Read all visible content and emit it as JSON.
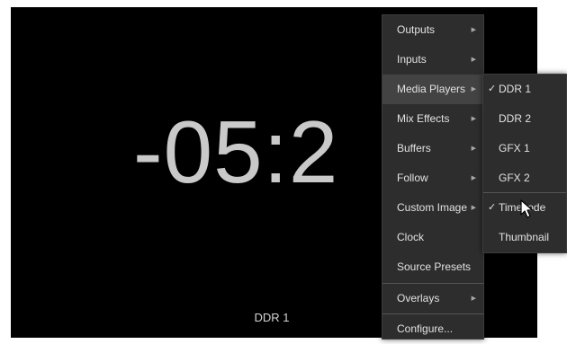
{
  "preview": {
    "timecode": "-05:2",
    "source_label": "DDR 1"
  },
  "main_menu": {
    "items": [
      {
        "label": "Outputs",
        "has_submenu": true
      },
      {
        "label": "Inputs",
        "has_submenu": true
      },
      {
        "label": "Media Players",
        "has_submenu": true
      },
      {
        "label": "Mix Effects",
        "has_submenu": true
      },
      {
        "label": "Buffers",
        "has_submenu": true
      },
      {
        "label": "Follow",
        "has_submenu": true
      },
      {
        "label": "Custom Image",
        "has_submenu": true
      },
      {
        "label": "Clock",
        "has_submenu": false
      },
      {
        "label": "Source Presets",
        "has_submenu": false
      },
      {
        "label": "Overlays",
        "has_submenu": true
      },
      {
        "label": "Configure...",
        "has_submenu": false
      }
    ],
    "highlighted": "Media Players"
  },
  "media_players_submenu": {
    "items": [
      {
        "label": "DDR 1",
        "checked": true
      },
      {
        "label": "DDR 2",
        "checked": false
      },
      {
        "label": "GFX 1",
        "checked": false
      },
      {
        "label": "GFX 2",
        "checked": false
      },
      {
        "label": "Timecode",
        "checked": true
      },
      {
        "label": "Thumbnail",
        "checked": false
      }
    ]
  },
  "symbols": {
    "submenu_arrow": "▶",
    "checkmark": "✓"
  },
  "colors": {
    "monitor_bg": "#000000",
    "timecode_text": "#c9c9c9",
    "menu_bg": "#2d2d2d",
    "menu_highlight": "#434343",
    "menu_text": "#e2e2e2"
  }
}
